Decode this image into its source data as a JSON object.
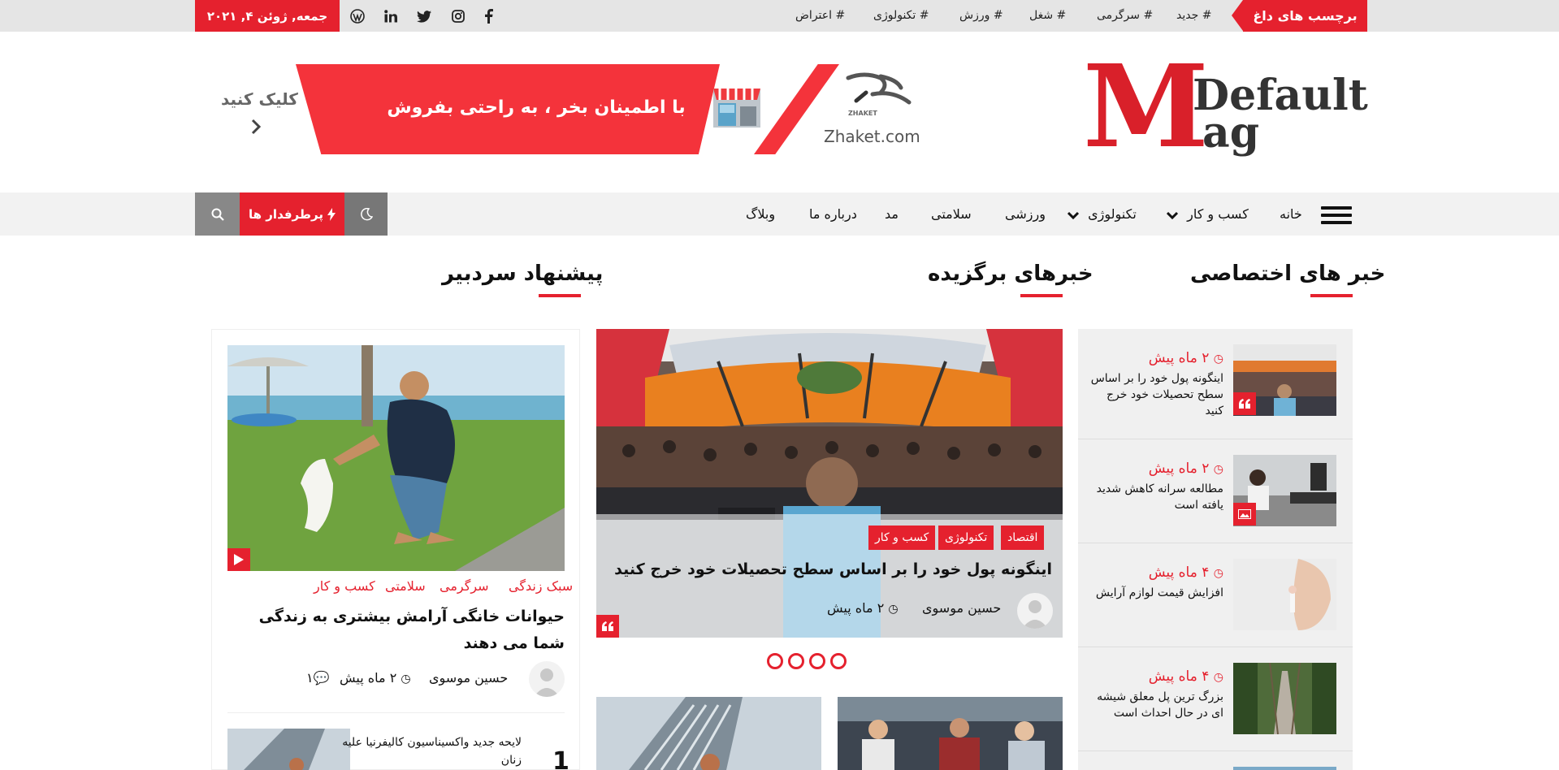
{
  "topbar": {
    "hot_tags_label": "برچسب های داغ",
    "tags": [
      "# جدید",
      "# سرگرمی",
      "# شغل",
      "# ورزش",
      "# تکنولوژی",
      "# اعتراض"
    ],
    "date": "جمعه, ژوئن ۴, ۲۰۲۱",
    "social_icons": [
      "facebook-icon",
      "instagram-icon",
      "twitter-icon",
      "linkedin-icon",
      "wordpress-icon"
    ]
  },
  "header": {
    "logo_letter": "M",
    "logo_word1": "Default",
    "logo_word2": "ag",
    "banner_text": "با اطمینان بخر ،  به راحتی بفروش",
    "zhaket_small": "ZHAKET",
    "zhaket_domain": "Zhaket.com",
    "click_text": "کلیک کنید"
  },
  "nav": {
    "items": [
      "خانه",
      "کسب و کار",
      "تکنولوژی",
      "ورزشی",
      "سلامتی",
      "مد",
      "درباره ما",
      "وبلاگ"
    ],
    "popular_label": "پرطرفدار ها"
  },
  "sections": {
    "exclusive": "خبر های اختصاصی",
    "featured": "خبرهای برگزیده",
    "editor": "پیشنهاد سردبیر"
  },
  "exclusive_items": [
    {
      "time": "۲ ماه پیش",
      "title": "اینگونه پول خود را بر اساس سطح تحصیلات خود خرج کنید"
    },
    {
      "time": "۲ ماه پیش",
      "title": "مطالعه سرانه کاهش شدید یافته است"
    },
    {
      "time": "۴ ماه پیش",
      "title": "افزایش قیمت لوازم آرایش"
    },
    {
      "time": "۴ ماه پیش",
      "title": "بزرگ ترین پل معلق شیشه ای در حال احداث است"
    }
  ],
  "featured_main": {
    "categories": [
      "اقتصاد",
      "تکنولوژی",
      "کسب و کار"
    ],
    "title": "اینگونه پول خود را بر اساس سطح تحصیلات خود خرج کنید",
    "author": "حسین موسوی",
    "time": "۲ ماه پیش"
  },
  "editor_pick": {
    "categories": [
      "سبک زندگی",
      "سرگرمی",
      "سلامتی",
      "کسب و کار"
    ],
    "title": "حیوانات خانگی آرامش بیشتری به زندگی شما می دهند",
    "author": "حسین موسوی",
    "time": "۲ ماه پیش",
    "comments": "۱",
    "list_title": "لایحه جدید واکسیناسیون کالیفرنیا علیه زنان",
    "list_number": "1"
  },
  "colors": {
    "accent": "#e5212e",
    "topbar_bg": "#e5e5e5",
    "nav_bg": "#f2f2f2"
  }
}
